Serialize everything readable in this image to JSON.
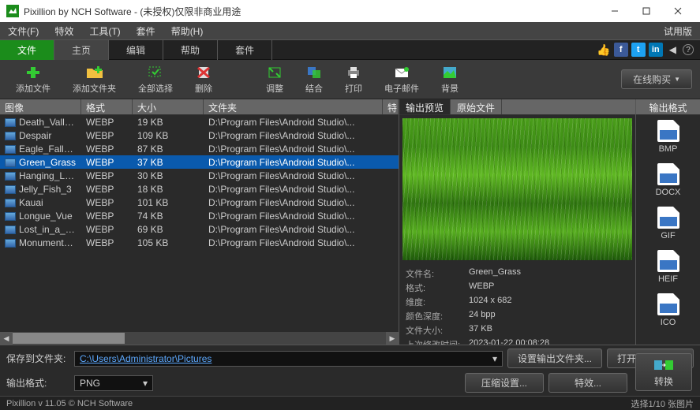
{
  "window": {
    "title": "Pixillion by NCH Software - (未授权)仅限非商业用途",
    "trial": "试用版"
  },
  "menu": {
    "items": [
      "文件(F)",
      "特效",
      "工具(T)",
      "套件",
      "帮助(H)"
    ]
  },
  "tabs": {
    "items": [
      "文件",
      "主页",
      "编辑",
      "帮助",
      "套件"
    ],
    "active": 0,
    "selected": 1
  },
  "toolbar": {
    "add_file": "添加文件",
    "add_folder": "添加文件夹",
    "select_all": "全部选择",
    "delete": "删除",
    "adjust": "调整",
    "combine": "结合",
    "print": "打印",
    "email": "电子邮件",
    "background": "背景",
    "buy": "在线购买"
  },
  "table": {
    "headers": {
      "image": "图像",
      "format": "格式",
      "size": "大小",
      "folder": "文件夹",
      "special": "特"
    },
    "rows": [
      {
        "name": "Death_Valley_...",
        "fmt": "WEBP",
        "size": "19 KB",
        "folder": "D:\\Program Files\\Android Studio\\..."
      },
      {
        "name": "Despair",
        "fmt": "WEBP",
        "size": "109 KB",
        "folder": "D:\\Program Files\\Android Studio\\..."
      },
      {
        "name": "Eagle_Fall_Su...",
        "fmt": "WEBP",
        "size": "87 KB",
        "folder": "D:\\Program Files\\Android Studio\\..."
      },
      {
        "name": "Green_Grass",
        "fmt": "WEBP",
        "size": "37 KB",
        "folder": "D:\\Program Files\\Android Studio\\...",
        "sel": true
      },
      {
        "name": "Hanging_Leaf",
        "fmt": "WEBP",
        "size": "30 KB",
        "folder": "D:\\Program Files\\Android Studio\\..."
      },
      {
        "name": "Jelly_Fish_3",
        "fmt": "WEBP",
        "size": "18 KB",
        "folder": "D:\\Program Files\\Android Studio\\..."
      },
      {
        "name": "Kauai",
        "fmt": "WEBP",
        "size": "101 KB",
        "folder": "D:\\Program Files\\Android Studio\\..."
      },
      {
        "name": "Longue_Vue",
        "fmt": "WEBP",
        "size": "74 KB",
        "folder": "D:\\Program Files\\Android Studio\\..."
      },
      {
        "name": "Lost_in_a_Field",
        "fmt": "WEBP",
        "size": "69 KB",
        "folder": "D:\\Program Files\\Android Studio\\..."
      },
      {
        "name": "Monument_Va...",
        "fmt": "WEBP",
        "size": "105 KB",
        "folder": "D:\\Program Files\\Android Studio\\..."
      }
    ]
  },
  "preview": {
    "tabs": [
      "输出预览",
      "原始文件"
    ],
    "meta": {
      "filename_k": "文件名:",
      "filename_v": "Green_Grass",
      "format_k": "格式:",
      "format_v": "WEBP",
      "dims_k": "维度:",
      "dims_v": "1024 x 682",
      "depth_k": "颜色深度:",
      "depth_v": "24 bpp",
      "fsize_k": "文件大小:",
      "fsize_v": "37 KB",
      "mtime_k": "上次修改时间:",
      "mtime_v": "2023-01-22 00:08:28"
    }
  },
  "formats": {
    "header": "输出格式",
    "items": [
      "BMP",
      "DOCX",
      "GIF",
      "HEIF",
      "ICO"
    ]
  },
  "bottom": {
    "save_label": "保存到文件夹:",
    "save_path": "C:\\Users\\Administrator\\Pictures",
    "fmt_label": "输出格式:",
    "fmt_value": "PNG",
    "set_folder": "设置输出文件夹...",
    "open_folder": "打开输出文件夹",
    "compress": "压缩设置...",
    "effects": "特效...",
    "convert": "转换"
  },
  "status": {
    "left": "Pixillion v 11.05   © NCH Software",
    "right": "选择1/10 张图片"
  }
}
